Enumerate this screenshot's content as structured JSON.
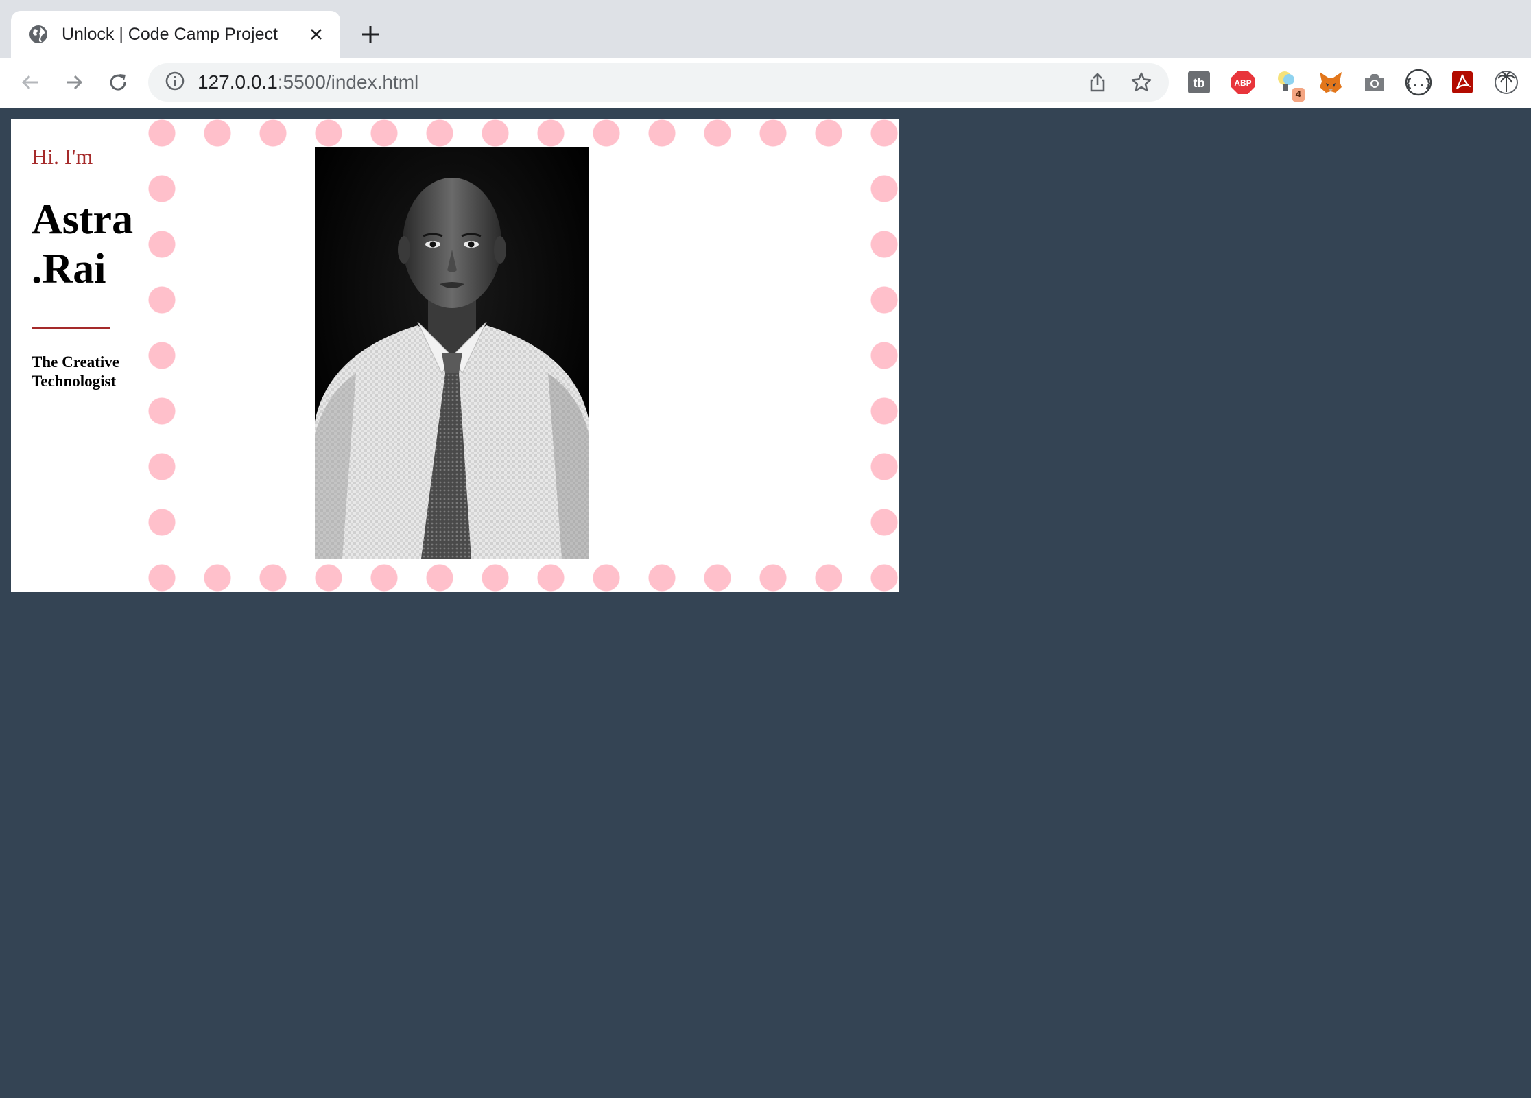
{
  "browser": {
    "tab_title": "Unlock | Code Camp Project",
    "url_host": "127.0.0.1",
    "url_path": ":5500/index.html",
    "extensions": [
      {
        "icon": "tb-extension-icon",
        "label": "tb"
      },
      {
        "icon": "adblock-plus-icon",
        "label": "ABP"
      },
      {
        "icon": "lightbulb-extension-icon",
        "badge": "4"
      },
      {
        "icon": "metamask-fox-icon"
      },
      {
        "icon": "camera-icon"
      },
      {
        "icon": "braces-extension-icon"
      },
      {
        "icon": "pdf-extension-icon"
      },
      {
        "icon": "palm-tree-extension-icon"
      }
    ]
  },
  "page": {
    "greeting": "Hi. I'm",
    "name_line1": "Astra",
    "name_line2": ".Rai",
    "tagline": "The Creative Technologist",
    "colors": {
      "background": "#344454",
      "accent": "#a52a2a",
      "dots": "#ffc0cb"
    },
    "portrait_alt": "portrait-photo"
  }
}
